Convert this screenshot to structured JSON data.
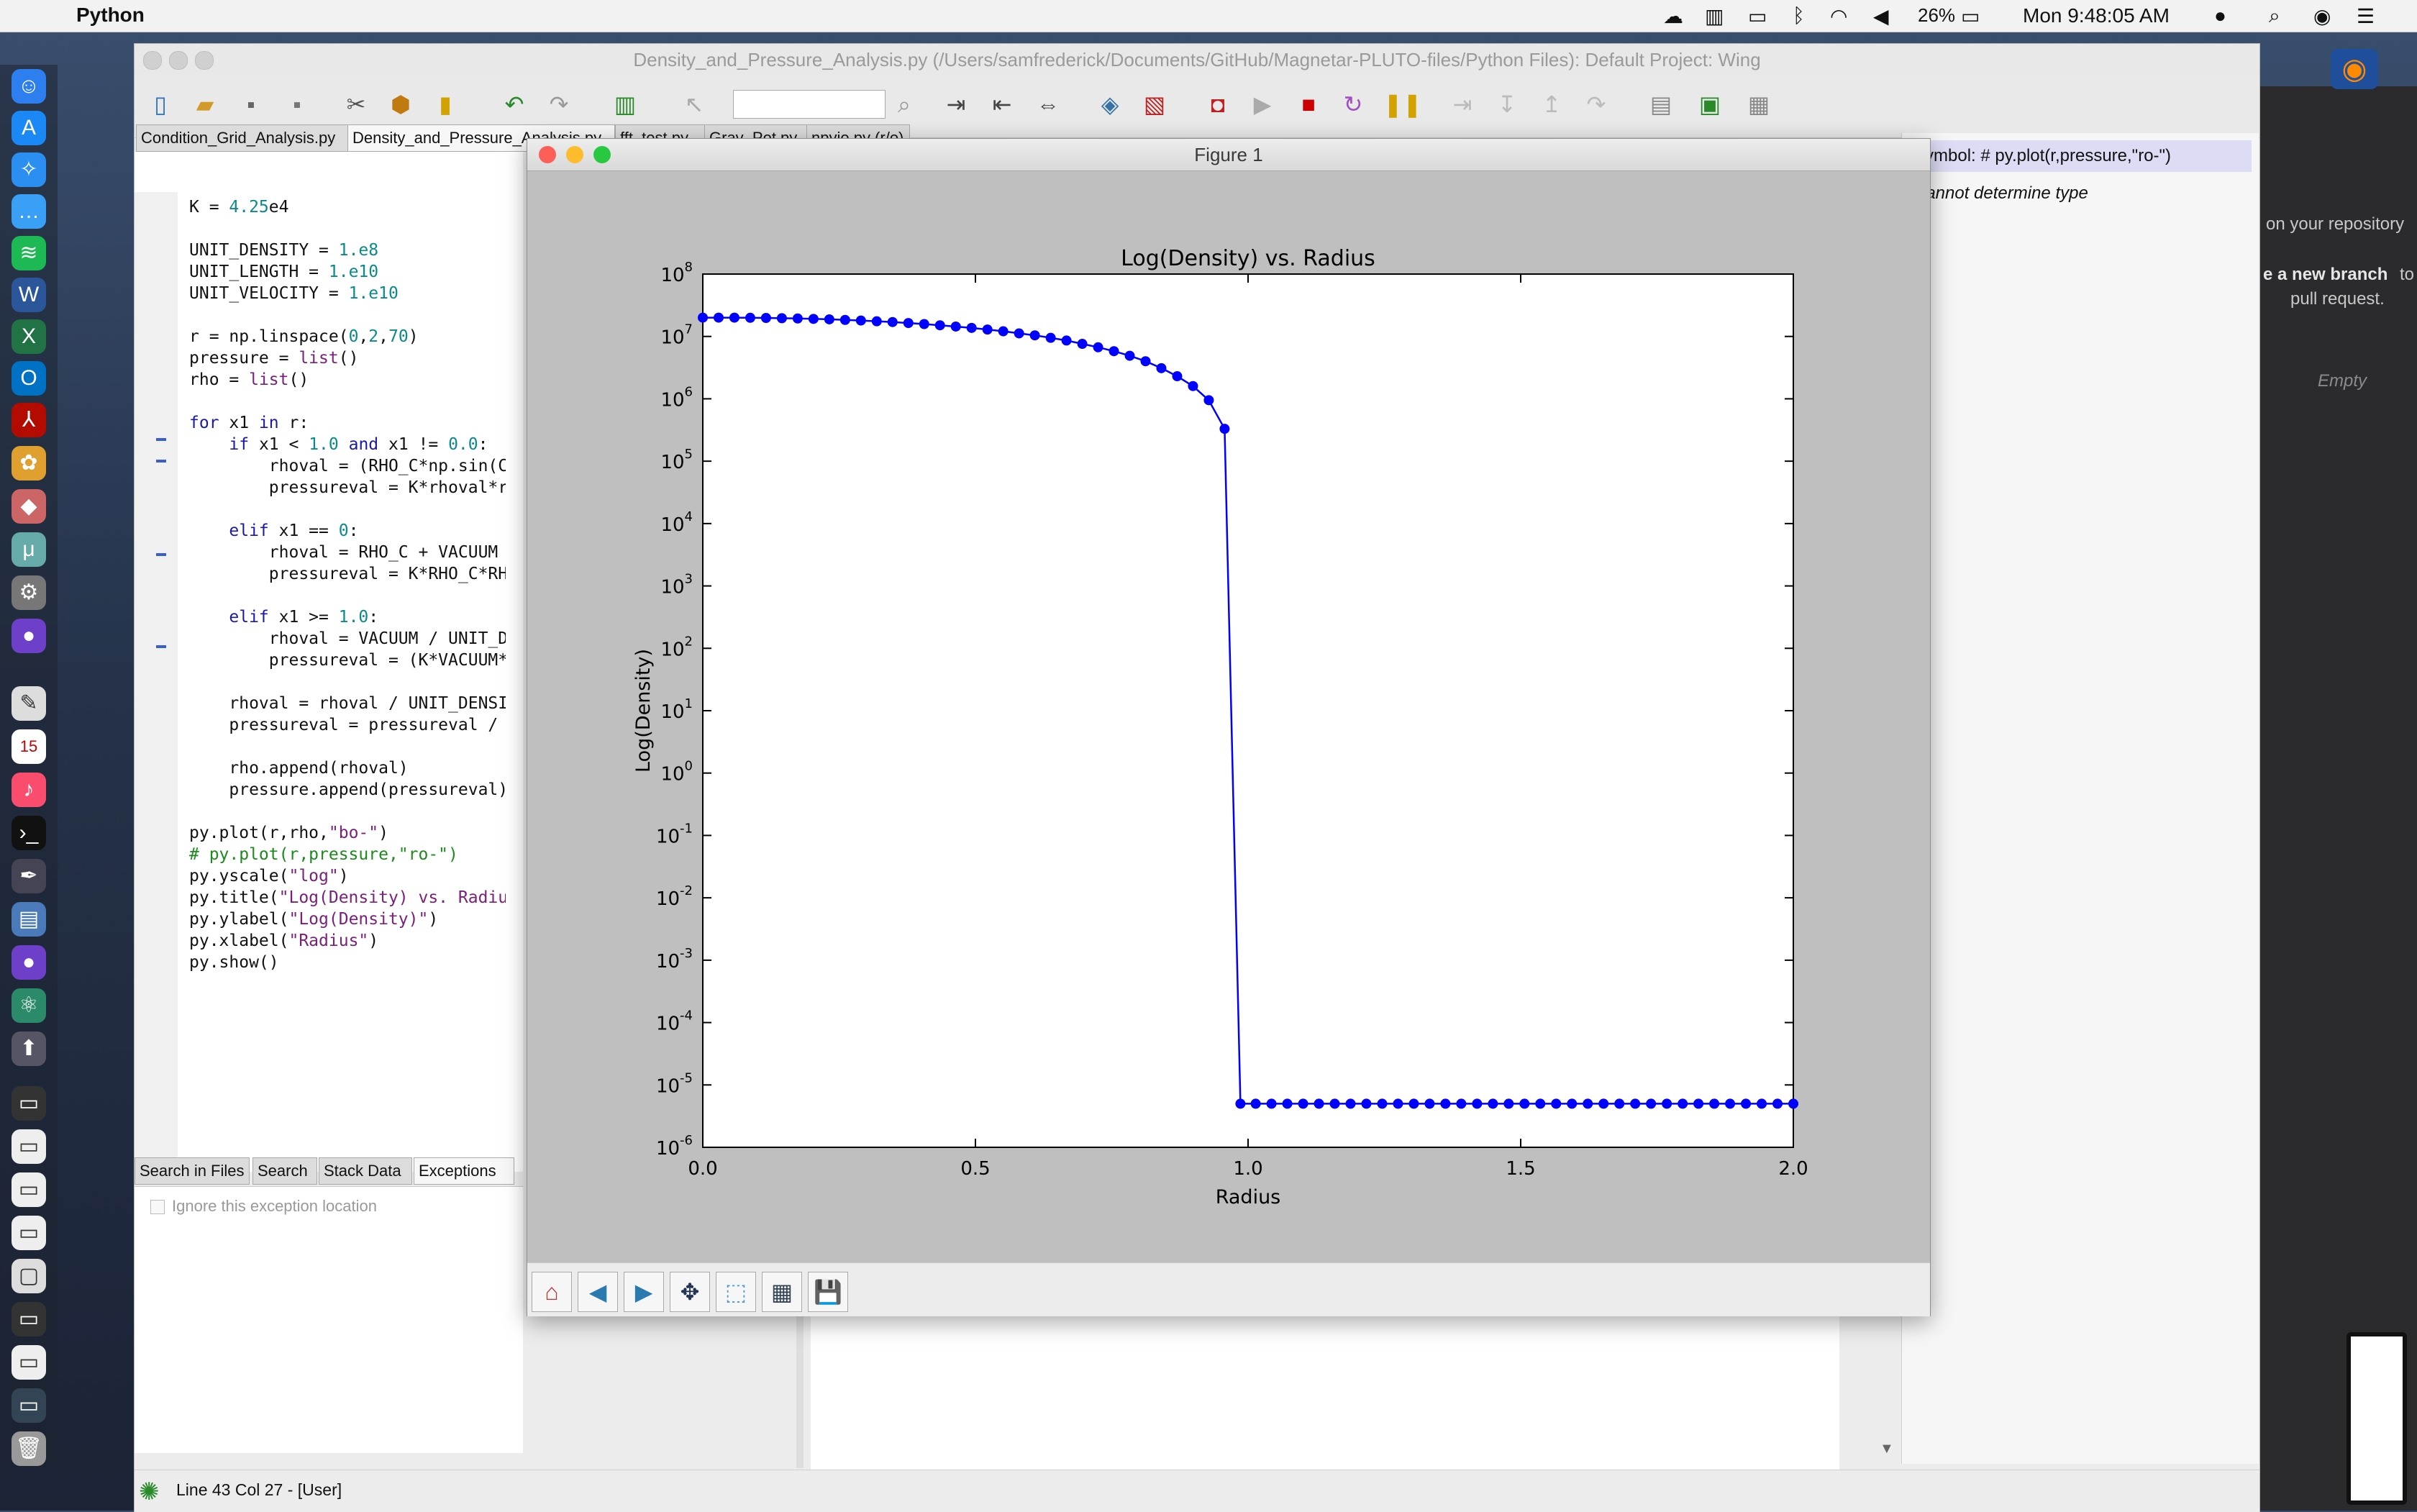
{
  "menubar": {
    "app_name": "Python",
    "battery": "26%",
    "clock": "Mon 9:48:05 AM"
  },
  "wing": {
    "window_title": "Density_and_Pressure_Analysis.py (/Users/samfrederick/Documents/GitHub/Magnetar-PLUTO-files/Python Files): Default Project: Wing",
    "tabs": [
      {
        "label": "Condition_Grid_Analysis.py"
      },
      {
        "label": "Density_and_Pressure_Analysis.py"
      },
      {
        "label": "fft_test.py"
      },
      {
        "label": "Grav_Pot.py"
      },
      {
        "label": "npyio.py (r/o)"
      }
    ],
    "code_lines": [
      "K = 4.25e4",
      "",
      "UNIT_DENSITY = 1.e8",
      "UNIT_LENGTH = 1.e10",
      "UNIT_VELOCITY = 1.e10",
      "",
      "r = np.linspace(0,2,70)",
      "pressure = list()",
      "rho = list()",
      "",
      "for x1 in r:",
      "    if x1 < 1.0 and x1 != 0.0:",
      "        rhoval = (RHO_C*np.sin(CO",
      "        pressureval = K*rhoval*rh",
      "",
      "    elif x1 == 0:",
      "        rhoval = RHO_C + VACUUM",
      "        pressureval = K*RHO_C*RHO",
      "",
      "    elif x1 >= 1.0:",
      "        rhoval = VACUUM / UNIT_DE",
      "        pressureval = (K*VACUUM*V",
      "",
      "    rhoval = rhoval / UNIT_DENSIT",
      "    pressureval = pressureval / (",
      "",
      "    rho.append(rhoval)",
      "    pressure.append(pressureval)",
      "",
      "py.plot(r,rho,\"bo-\")",
      "# py.plot(r,pressure,\"ro-\")",
      "py.yscale(\"log\")",
      "py.title(\"Log(Density) vs. Radius",
      "py.ylabel(\"Log(Density)\")",
      "py.xlabel(\"Radius\")",
      "py.show()"
    ],
    "bottom_tabs": [
      {
        "label": "Search in Files"
      },
      {
        "label": "Search"
      },
      {
        "label": "Stack Data"
      },
      {
        "label": "Exceptions"
      }
    ],
    "ignore_exception_label": "Ignore this exception location",
    "status": "Line 43 Col 27 - [User]",
    "right_panel": {
      "symbol": "Symbol: # py.plot(r,pressure,\"ro-\")",
      "type": "Cannot determine type"
    }
  },
  "desktop_right": {
    "text1": "on your repository",
    "text2": "e a new branch",
    "text3": "to",
    "text4": "pull request.",
    "text5": "Empty"
  },
  "figure": {
    "window_title": "Figure 1",
    "toolbar": [
      {
        "icon": "home-icon",
        "glyph": "⌂"
      },
      {
        "icon": "back-icon",
        "glyph": "◀"
      },
      {
        "icon": "forward-icon",
        "glyph": "▶"
      },
      {
        "icon": "pan-icon",
        "glyph": "✥"
      },
      {
        "icon": "zoom-icon",
        "glyph": "⬚"
      },
      {
        "icon": "subplots-icon",
        "glyph": "▦"
      },
      {
        "icon": "save-icon",
        "glyph": "💾"
      }
    ]
  },
  "chart_data": {
    "type": "line",
    "title": "Log(Density) vs. Radius",
    "xlabel": "Radius",
    "ylabel": "Log(Density)",
    "xlim": [
      0.0,
      2.0
    ],
    "ylim_exp": [
      -6,
      8
    ],
    "yscale": "log",
    "xticks": [
      "0.0",
      "0.5",
      "1.0",
      "1.5",
      "2.0"
    ],
    "ytick_exponents": [
      "8",
      "7",
      "6",
      "5",
      "4",
      "3",
      "2",
      "1",
      "0",
      "-1",
      "-2",
      "-3",
      "-4",
      "-5",
      "-6"
    ],
    "grid": false,
    "series": [
      {
        "color": "#0000ff",
        "marker": "circle",
        "x": [
          0.0,
          0.029,
          0.058,
          0.087,
          0.116,
          0.145,
          0.174,
          0.203,
          0.232,
          0.261,
          0.29,
          0.319,
          0.348,
          0.377,
          0.406,
          0.435,
          0.464,
          0.493,
          0.522,
          0.551,
          0.58,
          0.609,
          0.638,
          0.667,
          0.696,
          0.725,
          0.754,
          0.783,
          0.812,
          0.841,
          0.87,
          0.899,
          0.928,
          0.957,
          0.986,
          1.014,
          1.043,
          1.072,
          1.101,
          1.13,
          1.159,
          1.188,
          1.217,
          1.246,
          1.275,
          1.304,
          1.333,
          1.362,
          1.391,
          1.42,
          1.449,
          1.478,
          1.507,
          1.536,
          1.565,
          1.594,
          1.623,
          1.652,
          1.681,
          1.71,
          1.739,
          1.768,
          1.797,
          1.826,
          1.855,
          1.884,
          1.913,
          1.942,
          1.971,
          2.0
        ],
        "y": [
          20000000.0,
          20000000.0,
          20000000.0,
          19900000.0,
          19800000.0,
          19600000.0,
          19400000.0,
          19100000.0,
          18800000.0,
          18400000.0,
          18000000.0,
          17500000.0,
          17000000.0,
          16400000.0,
          15800000.0,
          15100000.0,
          14400000.0,
          13700000.0,
          12900000.0,
          12100000.0,
          11200000.0,
          10400000.0,
          9500000.0,
          8600000.0,
          7600000.0,
          6700000.0,
          5800000.0,
          4900000.0,
          4000000.0,
          3100000.0,
          2300000.0,
          1600000.0,
          950000.0,
          330000.0,
          5e-06,
          5e-06,
          5e-06,
          5e-06,
          5e-06,
          5e-06,
          5e-06,
          5e-06,
          5e-06,
          5e-06,
          5e-06,
          5e-06,
          5e-06,
          5e-06,
          5e-06,
          5e-06,
          5e-06,
          5e-06,
          5e-06,
          5e-06,
          5e-06,
          5e-06,
          5e-06,
          5e-06,
          5e-06,
          5e-06,
          5e-06,
          5e-06,
          5e-06,
          5e-06,
          5e-06,
          5e-06,
          5e-06,
          5e-06,
          5e-06,
          5e-06
        ]
      }
    ]
  }
}
